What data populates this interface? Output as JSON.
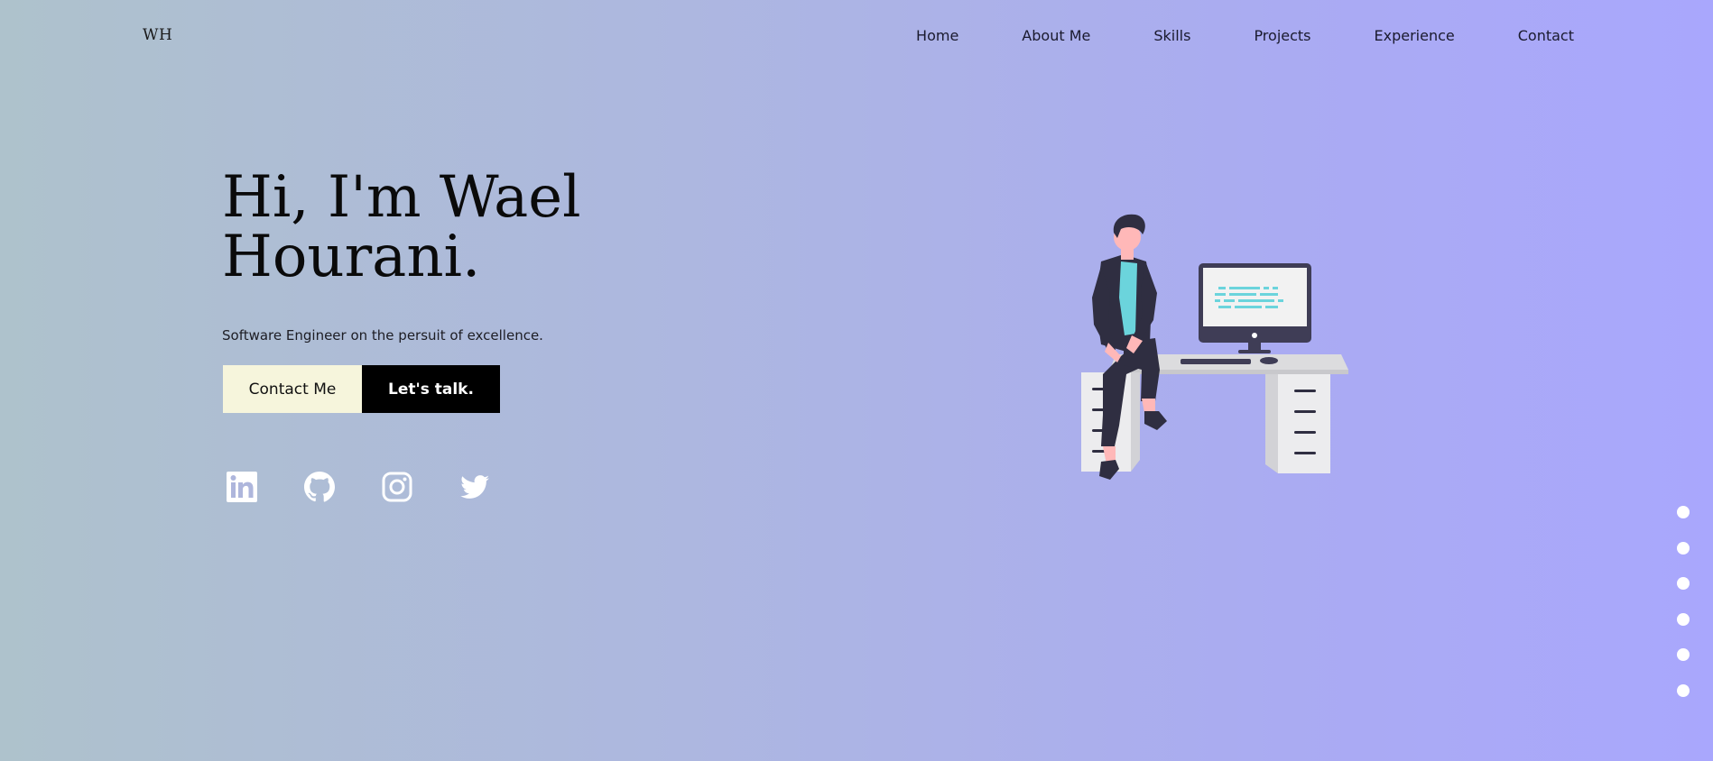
{
  "logo": "WH",
  "nav": {
    "items": [
      "Home",
      "About Me",
      "Skills",
      "Projects",
      "Experience",
      "Contact"
    ]
  },
  "hero": {
    "title_line1": "Hi, I'm Wael",
    "title_line2": "Hourani.",
    "subtitle": "Software Engineer on the persuit of excellence.",
    "contact_label": "Contact Me",
    "talk_label": "Let's talk."
  },
  "socials": [
    "linkedin-icon",
    "github-icon",
    "instagram-icon",
    "twitter-icon"
  ],
  "section_dots": 6,
  "colors": {
    "contact_button_bg": "#f6f5dc",
    "talk_button_bg": "#000000",
    "illustration_accent": "#6bd4dc",
    "illustration_dark": "#2f2e41"
  }
}
